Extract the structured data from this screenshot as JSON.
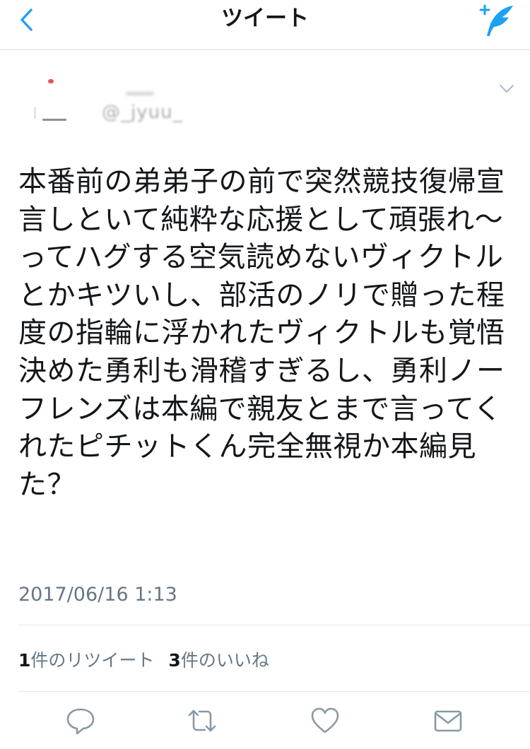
{
  "nav": {
    "title": "ツイート",
    "back_icon": "chevron-left-icon",
    "compose_icon": "compose-tweet-icon",
    "accent_color": "#1da1f2"
  },
  "author": {
    "handle": "@_jyuu_",
    "caret_icon": "chevron-down-icon"
  },
  "tweet": {
    "text": "本番前の弟弟子の前で突然競技復帰宣言しといて純粋な応援として頑張れ〜ってハグする空気読めないヴィクトルとかキツいし、部活のノリで贈った程度の指輪に浮かれたヴィクトルも覚悟決めた勇利も滑稽すぎるし、勇利ノーフレンズは本編で親友とまで言ってくれたピチットくん完全無視か本編見た？",
    "timestamp": "2017/06/16 1:13"
  },
  "stats": {
    "retweet_count": "1",
    "retweet_label": "件のリツイート",
    "like_count": "3",
    "like_label": "件のいいね"
  },
  "actions": [
    {
      "icon": "reply-icon"
    },
    {
      "icon": "retweet-icon"
    },
    {
      "icon": "like-icon"
    },
    {
      "icon": "direct-message-icon"
    }
  ]
}
